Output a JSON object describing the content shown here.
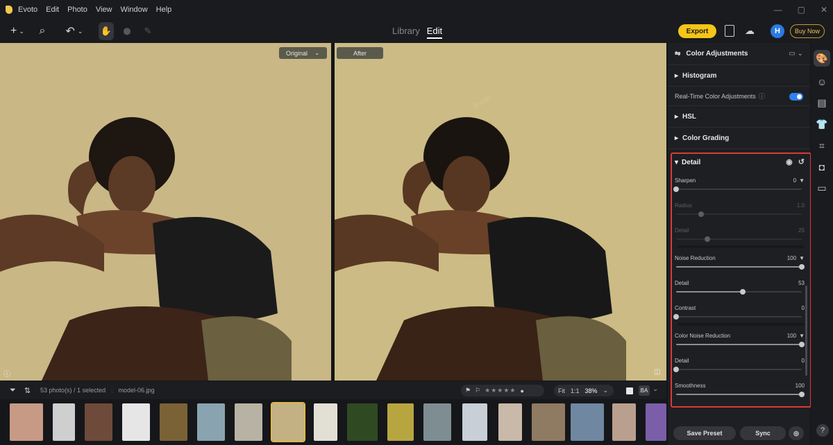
{
  "app": {
    "name": "Evoto"
  },
  "menu": [
    "Edit",
    "Photo",
    "View",
    "Window",
    "Help"
  ],
  "window_controls": [
    "—",
    "▢",
    "✕"
  ],
  "toolbar": {
    "add_icon": "+",
    "search_icon": "⌕",
    "undo_icon": "↶",
    "hand_icon": "✋",
    "stamp_icon": "⬤",
    "brush_icon": "✎",
    "tabs": {
      "library": "Library",
      "edit": "Edit"
    },
    "export_label": "Export",
    "avatar_letter": "H",
    "buy_now_label": "Buy Now"
  },
  "viewer": {
    "original_label": "Original",
    "after_label": "After",
    "watermark": "Evoto"
  },
  "panel": {
    "title": "Color Adjustments",
    "sections": {
      "histogram": "Histogram",
      "hsl": "HSL",
      "color_grading": "Color Grading",
      "detail": "Detail"
    },
    "realtime_label": "Real-Time Color Adjustments",
    "realtime_enabled": true
  },
  "detail": {
    "sharpen": {
      "label": "Sharpen",
      "value": "0",
      "fraction": 0
    },
    "radius": {
      "label": "Radius",
      "value": "1.0",
      "fraction": 0.2
    },
    "sharpen_detail": {
      "label": "Detail",
      "value": "25",
      "fraction": 0.25
    },
    "noise_reduction": {
      "label": "Noise Reduction",
      "value": "100",
      "fraction": 1.0
    },
    "nr_detail": {
      "label": "Detail",
      "value": "53",
      "fraction": 0.53
    },
    "contrast": {
      "label": "Contrast",
      "value": "0",
      "fraction": 0
    },
    "color_noise_reduction": {
      "label": "Color Noise Reduction",
      "value": "100",
      "fraction": 1.0
    },
    "cnr_detail": {
      "label": "Detail",
      "value": "0",
      "fraction": 0
    },
    "smoothness": {
      "label": "Smoothness",
      "value": "100",
      "fraction": 1.0
    }
  },
  "footer": {
    "save_preset": "Save Preset",
    "sync": "Sync"
  },
  "filmbar": {
    "count_text": "53 photo(s) / 1 selected",
    "filename": "model-06.jpg",
    "fit": "Fit",
    "one_to_one": "1:1",
    "zoom": "38%",
    "stars": "★★★★★"
  },
  "colors": {
    "accent": "#f5c518",
    "toggle": "#2f80ed",
    "highlight": "#d93a3a"
  }
}
